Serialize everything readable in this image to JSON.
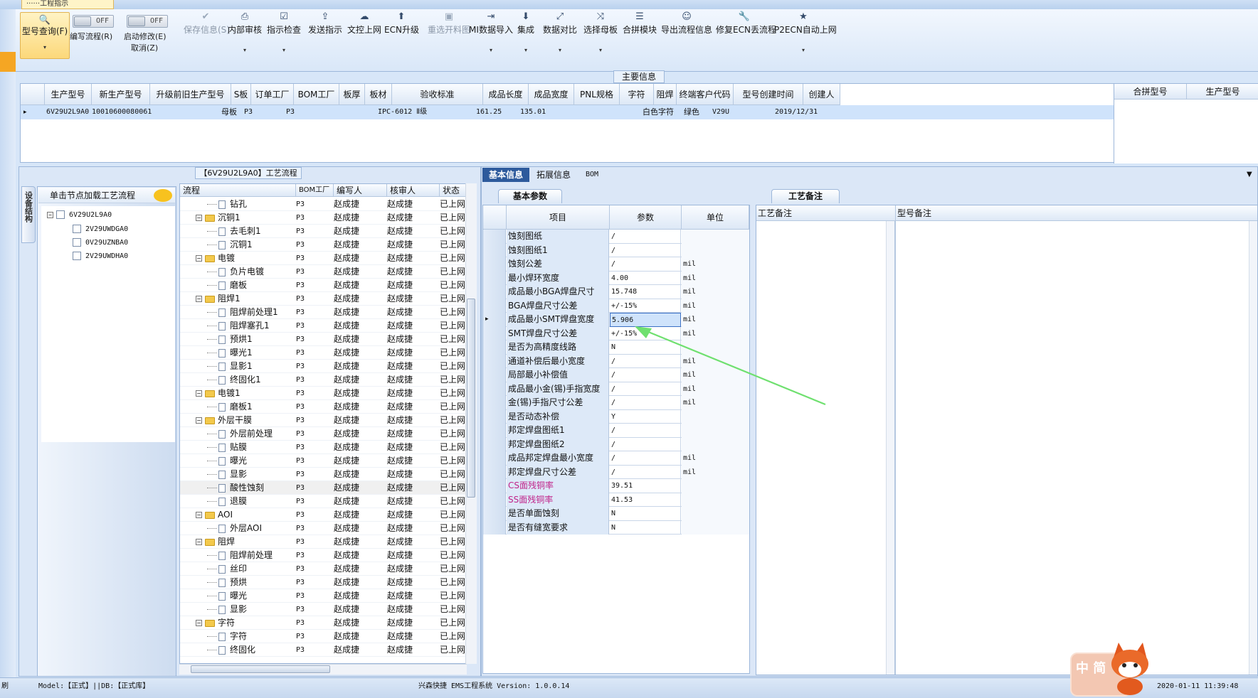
{
  "window": {
    "tab_title": "······工程指示"
  },
  "ribbon": {
    "query": {
      "label": "型号查询(F)",
      "arrow": "▾"
    },
    "write_flow": {
      "toggle": "OFF",
      "label": "编写流程(R)"
    },
    "start_modify": {
      "toggle": "OFF",
      "label": "启动修改(E)",
      "sub": "取消(Z)"
    },
    "buttons": [
      {
        "label": "保存信息(S)",
        "icon": "✔"
      },
      {
        "label": "内部审核",
        "icon": "⎙",
        "arrow": "▾"
      },
      {
        "label": "指示检查",
        "icon": "☑",
        "arrow": "▾"
      },
      {
        "label": "发送指示",
        "icon": "⇪"
      },
      {
        "label": "文控上网",
        "icon": "☁"
      },
      {
        "label": "ECN升级",
        "icon": "⬆"
      },
      {
        "label": "重选开料图",
        "icon": "▣"
      },
      {
        "label": "MI数据导入",
        "icon": "⇥",
        "arrow": "▾"
      },
      {
        "label": "集成",
        "icon": "⬇",
        "arrow": "▾"
      },
      {
        "label": "数据对比",
        "icon": "⤢",
        "arrow": "▾"
      },
      {
        "label": "选择母板",
        "icon": "⤨",
        "arrow": "▾"
      },
      {
        "label": "合拼模块",
        "icon": "☰"
      },
      {
        "label": "导出流程信息",
        "icon": "☺"
      },
      {
        "label": "修复ECN丢流程",
        "icon": "🔧"
      },
      {
        "label": "P2ECN自动上网",
        "icon": "★",
        "arrow": "▾"
      }
    ]
  },
  "main_info": {
    "title": "主要信息",
    "columns": [
      "生产型号",
      "新生产型号",
      "升级前旧生产型号",
      "S板",
      "订单工厂",
      "BOM工厂",
      "板厚",
      "板材",
      "验收标准",
      "成品长度",
      "成品宽度",
      "PNL规格",
      "字符",
      "阻焊",
      "终端客户代码",
      "型号创建时间",
      "创建人"
    ],
    "row": {
      "part_no": "6V29U2L9A0",
      "new_part_no": "10010600080061",
      "s_board": "母板",
      "order_factory": "P3",
      "bom_factory": "P3",
      "standard": "IPC-6012 Ⅱ级",
      "length": "161.25",
      "width": "135.01",
      "silkscreen": "白色字符",
      "solder_mask": "绿色",
      "customer_code": "V29U",
      "created": "2019/12/31"
    },
    "combine_columns": [
      "合拼型号",
      "生产型号"
    ]
  },
  "process": {
    "title": "【6V29U2L9A0】工艺流程",
    "side_tab": "设备结构",
    "tree_header": "单击节点加载工艺流程",
    "tree": {
      "root": "6V29U2L9A0",
      "children": [
        "2V29UWDGA0",
        "0V29UZNBA0",
        "2V29UWDHA0"
      ]
    },
    "columns": [
      "流程",
      "BOM工厂",
      "编写人",
      "核审人",
      "状态"
    ],
    "rows": [
      {
        "name": "钻孔",
        "level": 2,
        "factory": "P3",
        "writer": "赵成捷",
        "reviewer": "赵成捷",
        "status": "已上网"
      },
      {
        "name": "沉铜1",
        "level": 1,
        "factory": "P3",
        "writer": "赵成捷",
        "reviewer": "赵成捷",
        "status": "已上网"
      },
      {
        "name": "去毛刺1",
        "level": 2,
        "factory": "P3",
        "writer": "赵成捷",
        "reviewer": "赵成捷",
        "status": "已上网"
      },
      {
        "name": "沉铜1",
        "level": 2,
        "factory": "P3",
        "writer": "赵成捷",
        "reviewer": "赵成捷",
        "status": "已上网"
      },
      {
        "name": "电镀",
        "level": 1,
        "factory": "P3",
        "writer": "赵成捷",
        "reviewer": "赵成捷",
        "status": "已上网"
      },
      {
        "name": "负片电镀",
        "level": 2,
        "factory": "P3",
        "writer": "赵成捷",
        "reviewer": "赵成捷",
        "status": "已上网"
      },
      {
        "name": "磨板",
        "level": 2,
        "factory": "P3",
        "writer": "赵成捷",
        "reviewer": "赵成捷",
        "status": "已上网"
      },
      {
        "name": "阻焊1",
        "level": 1,
        "factory": "P3",
        "writer": "赵成捷",
        "reviewer": "赵成捷",
        "status": "已上网"
      },
      {
        "name": "阻焊前处理1",
        "level": 2,
        "factory": "P3",
        "writer": "赵成捷",
        "reviewer": "赵成捷",
        "status": "已上网"
      },
      {
        "name": "阻焊塞孔1",
        "level": 2,
        "factory": "P3",
        "writer": "赵成捷",
        "reviewer": "赵成捷",
        "status": "已上网"
      },
      {
        "name": "预烘1",
        "level": 2,
        "factory": "P3",
        "writer": "赵成捷",
        "reviewer": "赵成捷",
        "status": "已上网"
      },
      {
        "name": "曝光1",
        "level": 2,
        "factory": "P3",
        "writer": "赵成捷",
        "reviewer": "赵成捷",
        "status": "已上网"
      },
      {
        "name": "显影1",
        "level": 2,
        "factory": "P3",
        "writer": "赵成捷",
        "reviewer": "赵成捷",
        "status": "已上网"
      },
      {
        "name": "终固化1",
        "level": 2,
        "factory": "P3",
        "writer": "赵成捷",
        "reviewer": "赵成捷",
        "status": "已上网"
      },
      {
        "name": "电镀1",
        "level": 1,
        "factory": "P3",
        "writer": "赵成捷",
        "reviewer": "赵成捷",
        "status": "已上网"
      },
      {
        "name": "磨板1",
        "level": 2,
        "factory": "P3",
        "writer": "赵成捷",
        "reviewer": "赵成捷",
        "status": "已上网"
      },
      {
        "name": "外层干膜",
        "level": 1,
        "factory": "P3",
        "writer": "赵成捷",
        "reviewer": "赵成捷",
        "status": "已上网"
      },
      {
        "name": "外层前处理",
        "level": 2,
        "factory": "P3",
        "writer": "赵成捷",
        "reviewer": "赵成捷",
        "status": "已上网"
      },
      {
        "name": "贴膜",
        "level": 2,
        "factory": "P3",
        "writer": "赵成捷",
        "reviewer": "赵成捷",
        "status": "已上网"
      },
      {
        "name": "曝光",
        "level": 2,
        "factory": "P3",
        "writer": "赵成捷",
        "reviewer": "赵成捷",
        "status": "已上网"
      },
      {
        "name": "显影",
        "level": 2,
        "factory": "P3",
        "writer": "赵成捷",
        "reviewer": "赵成捷",
        "status": "已上网"
      },
      {
        "name": "酸性蚀刻",
        "level": 2,
        "factory": "P3",
        "writer": "赵成捷",
        "reviewer": "赵成捷",
        "status": "已上网",
        "selected": true
      },
      {
        "name": "退膜",
        "level": 2,
        "factory": "P3",
        "writer": "赵成捷",
        "reviewer": "赵成捷",
        "status": "已上网"
      },
      {
        "name": "AOI",
        "level": 1,
        "factory": "P3",
        "writer": "赵成捷",
        "reviewer": "赵成捷",
        "status": "已上网"
      },
      {
        "name": "外层AOI",
        "level": 2,
        "factory": "P3",
        "writer": "赵成捷",
        "reviewer": "赵成捷",
        "status": "已上网"
      },
      {
        "name": "阻焊",
        "level": 1,
        "factory": "P3",
        "writer": "赵成捷",
        "reviewer": "赵成捷",
        "status": "已上网"
      },
      {
        "name": "阻焊前处理",
        "level": 2,
        "factory": "P3",
        "writer": "赵成捷",
        "reviewer": "赵成捷",
        "status": "已上网"
      },
      {
        "name": "丝印",
        "level": 2,
        "factory": "P3",
        "writer": "赵成捷",
        "reviewer": "赵成捷",
        "status": "已上网"
      },
      {
        "name": "预烘",
        "level": 2,
        "factory": "P3",
        "writer": "赵成捷",
        "reviewer": "赵成捷",
        "status": "已上网"
      },
      {
        "name": "曝光",
        "level": 2,
        "factory": "P3",
        "writer": "赵成捷",
        "reviewer": "赵成捷",
        "status": "已上网"
      },
      {
        "name": "显影",
        "level": 2,
        "factory": "P3",
        "writer": "赵成捷",
        "reviewer": "赵成捷",
        "status": "已上网"
      },
      {
        "name": "字符",
        "level": 1,
        "factory": "P3",
        "writer": "赵成捷",
        "reviewer": "赵成捷",
        "status": "已上网"
      },
      {
        "name": "字符",
        "level": 2,
        "factory": "P3",
        "writer": "赵成捷",
        "reviewer": "赵成捷",
        "status": "已上网"
      },
      {
        "name": "终固化",
        "level": 2,
        "factory": "P3",
        "writer": "赵成捷",
        "reviewer": "赵成捷",
        "status": "已上网"
      }
    ]
  },
  "right": {
    "tabs": [
      "基本信息",
      "拓展信息",
      "BOM"
    ],
    "basic_params": {
      "subtab": "基本参数",
      "columns": [
        "项目",
        "参数",
        "单位"
      ],
      "rows": [
        {
          "item": "蚀刻图纸",
          "value": "/",
          "unit": ""
        },
        {
          "item": "蚀刻图纸1",
          "value": "/",
          "unit": ""
        },
        {
          "item": "蚀刻公差",
          "value": "/",
          "unit": "mil"
        },
        {
          "item": "最小焊环宽度",
          "value": "4.00",
          "unit": "mil"
        },
        {
          "item": "成品最小BGA焊盘尺寸",
          "value": "15.748",
          "unit": "mil"
        },
        {
          "item": "BGA焊盘尺寸公差",
          "value": "+/-15%",
          "unit": "mil"
        },
        {
          "item": "成品最小SMT焊盘宽度",
          "value": "5.906",
          "unit": "mil",
          "current": true
        },
        {
          "item": "SMT焊盘尺寸公差",
          "value": "+/-15%",
          "unit": "mil"
        },
        {
          "item": "是否为高精度线路",
          "value": "N",
          "unit": ""
        },
        {
          "item": "通道补偿后最小宽度",
          "value": "/",
          "unit": "mil"
        },
        {
          "item": "局部最小补偿值",
          "value": "/",
          "unit": "mil"
        },
        {
          "item": "成品最小金(锡)手指宽度",
          "value": "/",
          "unit": "mil"
        },
        {
          "item": "金(锡)手指尺寸公差",
          "value": "/",
          "unit": "mil"
        },
        {
          "item": "是否动态补偿",
          "value": "Y",
          "unit": ""
        },
        {
          "item": "邦定焊盘图纸1",
          "value": "/",
          "unit": ""
        },
        {
          "item": "邦定焊盘图纸2",
          "value": "/",
          "unit": ""
        },
        {
          "item": "成品邦定焊盘最小宽度",
          "value": "/",
          "unit": "mil"
        },
        {
          "item": "邦定焊盘尺寸公差",
          "value": "/",
          "unit": "mil"
        },
        {
          "item": "CS面残铜率",
          "value": "39.51",
          "unit": "",
          "pink": true
        },
        {
          "item": "SS面残铜率",
          "value": "41.53",
          "unit": "",
          "pink": true
        },
        {
          "item": "是否单面蚀刻",
          "value": "N",
          "unit": ""
        },
        {
          "item": "是否有缝宽要求",
          "value": "N",
          "unit": ""
        }
      ]
    },
    "remarks": {
      "subtab": "工艺备注",
      "col1": "工艺备注",
      "col2": "型号备注"
    }
  },
  "status": {
    "left": "刷",
    "model": "Model:【正式】||DB:【正式库】",
    "center": "兴森快捷 EMS工程系统 Version: 1.0.0.14",
    "datetime": "2020-01-11 11:39:48"
  },
  "ime": {
    "label": "中 简"
  },
  "colors": {
    "accent": "#2d5a9c",
    "highlight_row": "#cfe3fb",
    "pink_text": "#c0248a",
    "arrow": "#6fe06f"
  }
}
